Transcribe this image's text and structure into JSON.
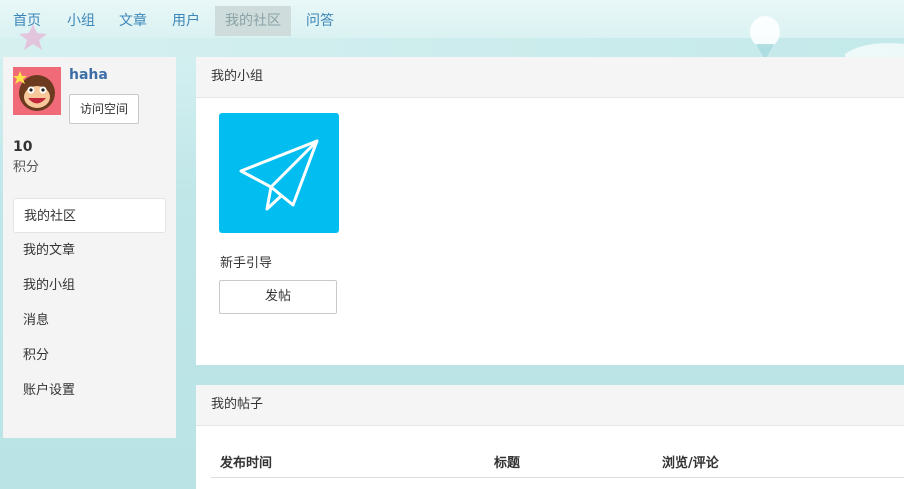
{
  "nav": {
    "items": [
      {
        "label": "首页",
        "active": false
      },
      {
        "label": "小组",
        "active": false
      },
      {
        "label": "文章",
        "active": false
      },
      {
        "label": "用户",
        "active": false
      },
      {
        "label": "我的社区",
        "active": true
      },
      {
        "label": "问答",
        "active": false
      }
    ]
  },
  "profile": {
    "username": "haha",
    "visit_button": "访问空间",
    "points_value": "10",
    "points_label": "积分",
    "avatar_icon": "monkey-avatar-icon"
  },
  "sidebar_menu": {
    "items": [
      {
        "label": "我的社区",
        "active": true
      },
      {
        "label": "我的文章",
        "active": false
      },
      {
        "label": "我的小组",
        "active": false
      },
      {
        "label": "消息",
        "active": false
      },
      {
        "label": "积分",
        "active": false
      },
      {
        "label": "账户设置",
        "active": false
      }
    ]
  },
  "groups_panel": {
    "title": "我的小组",
    "group": {
      "name": "新手引导",
      "post_button": "发帖",
      "icon": "paper-plane-icon",
      "color": "#01bdf0"
    }
  },
  "posts_panel": {
    "title": "我的帖子",
    "columns": [
      "发布时间",
      "标题",
      "浏览/评论"
    ]
  },
  "colors": {
    "link": "#3d86b8",
    "group_tile": "#01bdf0",
    "avatar_bg": "#f06a78"
  }
}
